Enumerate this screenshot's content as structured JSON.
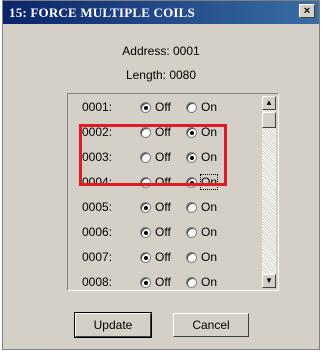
{
  "window": {
    "title": "15: FORCE MULTIPLE COILS",
    "close_label": "×"
  },
  "info": {
    "address": "Address: 0001",
    "length": "Length: 0080"
  },
  "coils": [
    {
      "address": "0001:",
      "off_label": "Off",
      "on_label": "On",
      "value": "Off"
    },
    {
      "address": "0002:",
      "off_label": "Off",
      "on_label": "On",
      "value": "On"
    },
    {
      "address": "0003:",
      "off_label": "Off",
      "on_label": "On",
      "value": "On"
    },
    {
      "address": "0004:",
      "off_label": "Off",
      "on_label": "On",
      "value": "On"
    },
    {
      "address": "0005:",
      "off_label": "Off",
      "on_label": "On",
      "value": "Off"
    },
    {
      "address": "0006:",
      "off_label": "Off",
      "on_label": "On",
      "value": "Off"
    },
    {
      "address": "0007:",
      "off_label": "Off",
      "on_label": "On",
      "value": "Off"
    },
    {
      "address": "0008:",
      "off_label": "Off",
      "on_label": "On",
      "value": "Off"
    }
  ],
  "buttons": {
    "update": "Update",
    "cancel": "Cancel"
  },
  "colors": {
    "highlight": "#e01b24",
    "titlebar": "#0a246a"
  }
}
